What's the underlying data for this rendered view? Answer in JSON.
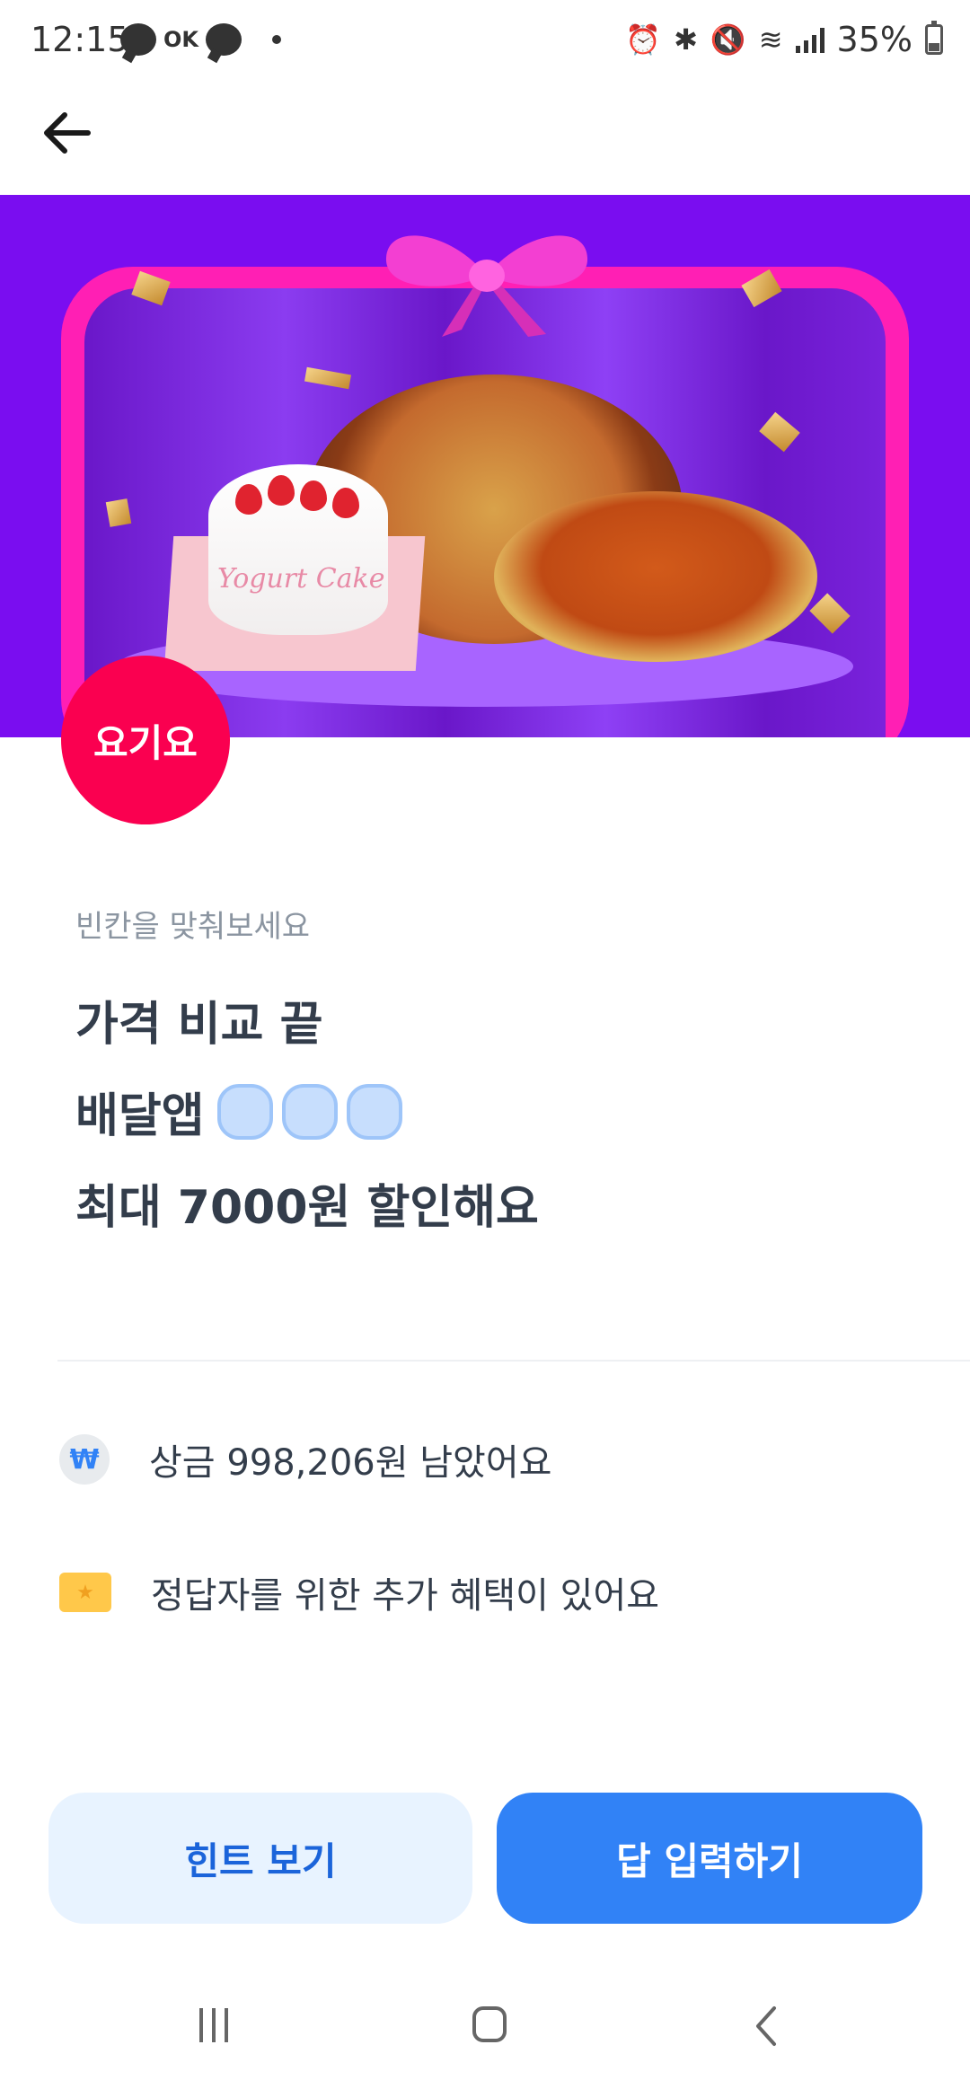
{
  "status_bar": {
    "time": "12:15",
    "notif_text": "OK",
    "battery_percent": "35%",
    "battery_level": 0.35
  },
  "toolbar": {
    "back_icon": "arrow-left-icon"
  },
  "banner": {
    "cake_text": "Yogurt Cake",
    "brand_badge_label": "요기요",
    "brand_color": "#fa0050"
  },
  "quiz": {
    "hint_label": "빈칸을 맞춰보세요",
    "line1": "가격 비교 끝",
    "line2_prefix": "배달앱",
    "blank_count": 3,
    "line3": "최대 7000원 할인해요"
  },
  "info": {
    "prize_text": "상금 998,206원 남았어요",
    "prize_icon": "won-icon",
    "prize_icon_glyph": "₩",
    "benefit_text": "정답자를 위한 추가 혜택이 있어요",
    "benefit_icon": "ticket-icon"
  },
  "actions": {
    "hint_button": "힌트 보기",
    "answer_button": "답 입력하기",
    "accent_color": "#3182f6"
  }
}
